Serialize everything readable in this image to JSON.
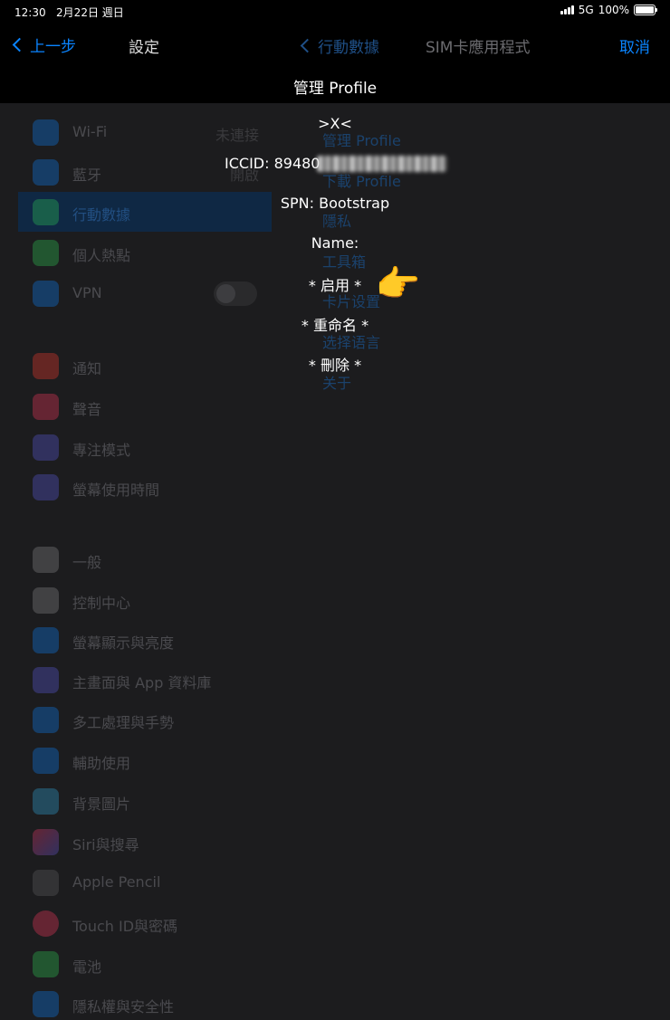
{
  "status_bar": {
    "time": "12:30",
    "date": "2月22日 週日",
    "network": "5G",
    "battery": "100%"
  },
  "nav": {
    "back_label": "上一步",
    "settings_title": "設定",
    "mid_back_label": "行動數據",
    "sim_title": "SIM卡應用程式",
    "cancel_label": "取消"
  },
  "modal": {
    "title": "管理 Profile",
    "marker": ">X<",
    "iccid_label": "ICCID: 89480",
    "spn": "SPN: Bootstrap",
    "name": "Name:",
    "options": [
      "* 启用 *",
      "* 重命名 *",
      "* 刪除 *"
    ],
    "pointer_icon": "pointing-hand-icon"
  },
  "sidebar": {
    "items": [
      {
        "label": "Wi-Fi",
        "value": "未連接",
        "icon": "wifi-icon",
        "color": "#0a84ff"
      },
      {
        "label": "藍牙",
        "value": "開啟",
        "icon": "bluetooth-icon",
        "color": "#0a84ff"
      },
      {
        "label": "行動數據",
        "icon": "antenna-icon",
        "color": "#30d158",
        "selected": true
      },
      {
        "label": "個人熱點",
        "icon": "hotspot-icon",
        "color": "#30d158"
      },
      {
        "label": "VPN",
        "icon": "vpn-icon",
        "color": "#0a84ff",
        "toggle": true
      },
      {
        "label": "通知",
        "icon": "bell-icon",
        "color": "#ff3b30"
      },
      {
        "label": "聲音",
        "icon": "speaker-icon",
        "color": "#ff375f"
      },
      {
        "label": "專注模式",
        "icon": "moon-icon",
        "color": "#5e5ce6"
      },
      {
        "label": "螢幕使用時間",
        "icon": "hourglass-icon",
        "color": "#5e5ce6"
      },
      {
        "label": "一般",
        "icon": "gear-icon",
        "color": "#8e8e93"
      },
      {
        "label": "控制中心",
        "icon": "switches-icon",
        "color": "#8e8e93"
      },
      {
        "label": "螢幕顯示與亮度",
        "icon": "sun-icon",
        "color": "#0a84ff"
      },
      {
        "label": "主畫面與 App 資料庫",
        "icon": "grid-icon",
        "color": "#5e5ce6"
      },
      {
        "label": "多工處理與手勢",
        "icon": "multitask-icon",
        "color": "#0a84ff"
      },
      {
        "label": "輔助使用",
        "icon": "accessibility-icon",
        "color": "#0a84ff"
      },
      {
        "label": "背景圖片",
        "icon": "flower-icon",
        "color": "#32ade6"
      },
      {
        "label": "Siri與搜尋",
        "icon": "siri-icon",
        "color": "#222222"
      },
      {
        "label": "Apple Pencil",
        "icon": "pencil-icon",
        "color": "#636366"
      },
      {
        "label": "Touch ID與密碼",
        "icon": "fingerprint-icon",
        "color": "#ff375f"
      },
      {
        "label": "電池",
        "icon": "battery-icon",
        "color": "#30d158"
      },
      {
        "label": "隱私權與安全性",
        "icon": "hand-icon",
        "color": "#0a84ff"
      }
    ]
  },
  "sim_menu": {
    "items": [
      "管理 Profile",
      "下載 Profile",
      "隱私",
      "工具箱",
      "卡片设置",
      "选择语言",
      "关于"
    ]
  }
}
